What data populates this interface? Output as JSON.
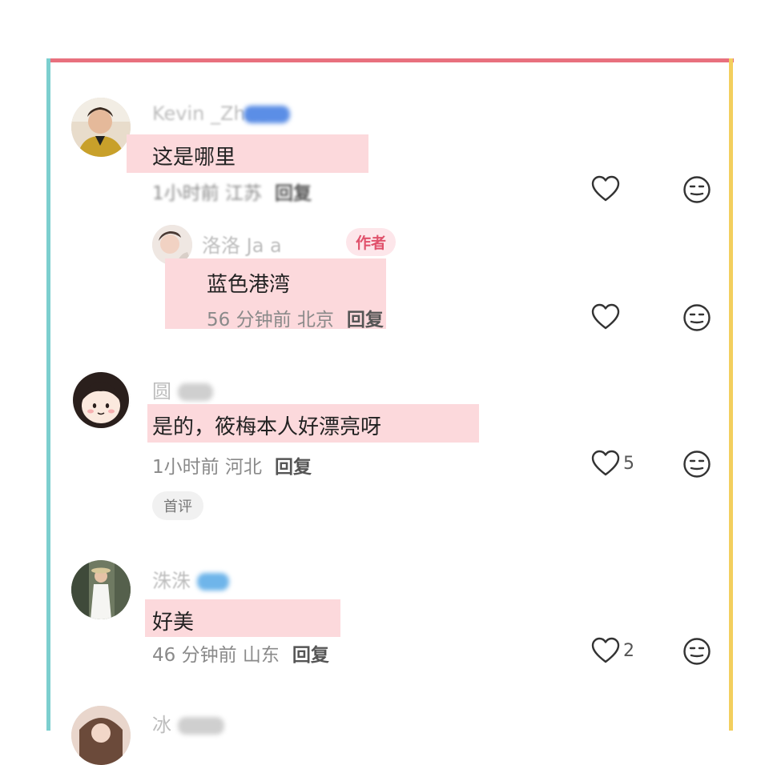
{
  "comments": [
    {
      "name": "Kevin _Zhao",
      "text": "这是哪里",
      "meta": "1小时前 江苏",
      "reply_label": "回复",
      "likes": ""
    },
    {
      "name": "洛洛 Ja   a",
      "author_tag": "作者",
      "text": "蓝色港湾",
      "meta": "56 分钟前 北京",
      "reply_label": "回复",
      "likes": ""
    },
    {
      "name": "圆",
      "text": "是的，筱梅本人好漂亮呀",
      "meta": "1小时前 河北",
      "reply_label": "回复",
      "likes": "5",
      "first_tag": "首评"
    },
    {
      "name": "洙洙",
      "text": "好美",
      "meta": "46 分钟前 山东",
      "reply_label": "回复",
      "likes": "2"
    },
    {
      "name": "冰"
    }
  ],
  "icons": {
    "like": "heart-outline-icon",
    "dislike": "meh-face-icon"
  },
  "colors": {
    "highlight": "#fcd9dc",
    "frame_top": "#e8707e",
    "frame_left": "#7ccfcf",
    "frame_right": "#f3cf5e",
    "author_tag": "#e0526c"
  }
}
